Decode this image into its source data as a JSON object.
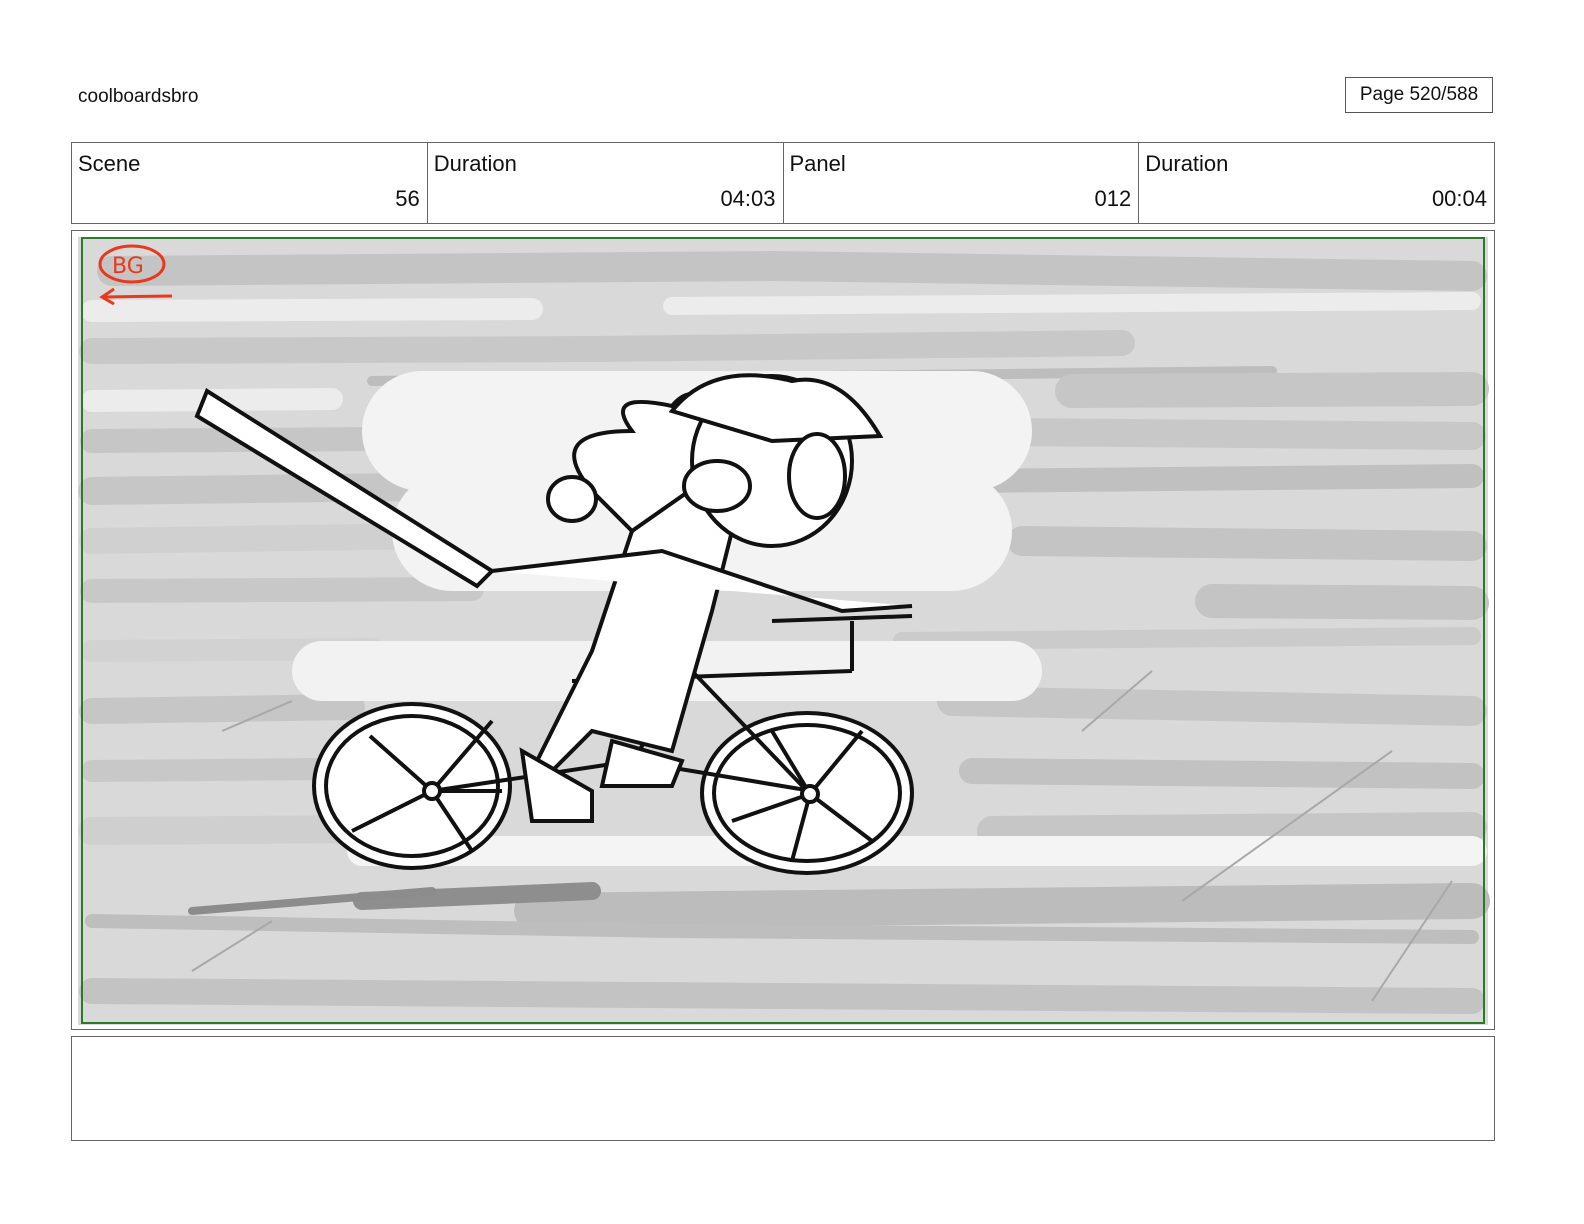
{
  "header": {
    "project_name": "coolboardsbro",
    "page_label": "Page 520/588"
  },
  "info": [
    {
      "label": "Scene",
      "value": "56"
    },
    {
      "label": "Duration",
      "value": "04:03"
    },
    {
      "label": "Panel",
      "value": "012"
    },
    {
      "label": "Duration",
      "value": "00:04"
    }
  ],
  "panel": {
    "annotation": "BG",
    "annotation_color": "#e8391c",
    "safe_frame_color": "#2a7a2a"
  },
  "notes": {
    "text": ""
  }
}
